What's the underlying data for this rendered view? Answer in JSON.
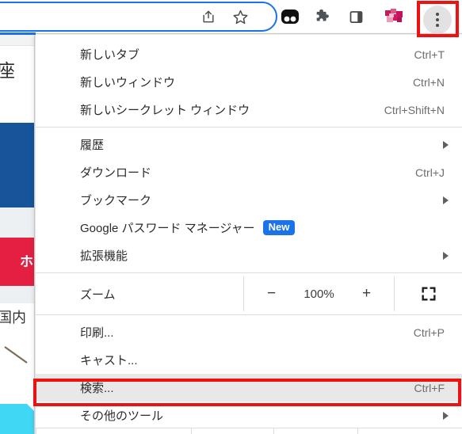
{
  "toolbar": {
    "icons": [
      {
        "name": "share-icon",
        "glyph": "share"
      },
      {
        "name": "bookmark-star-icon",
        "glyph": "star"
      },
      {
        "name": "extension-pin-goggles-icon",
        "glyph": "goggles"
      },
      {
        "name": "extensions-puzzle-icon",
        "glyph": "puzzle"
      },
      {
        "name": "side-panel-icon",
        "glyph": "panel"
      },
      {
        "name": "profile-avatar-icon",
        "glyph": "avatar"
      }
    ],
    "menu_button_label": "Google Chrome の設定",
    "accent_color": "#1a73e8",
    "highlight_color": "#ee1111"
  },
  "background": {
    "sidebar_text_1": "座",
    "sidebar_red_text": "ホ",
    "sidebar_text_2": "国内",
    "blue_color": "#17549a",
    "red_color": "#e51f42",
    "cyan_color": "#40d7f5"
  },
  "menu": {
    "groups": [
      {
        "items": [
          {
            "label": "新しいタブ",
            "accel": "Ctrl+T",
            "arrow": false,
            "badge": "",
            "highlighted": false
          },
          {
            "label": "新しいウィンドウ",
            "accel": "Ctrl+N",
            "arrow": false,
            "badge": "",
            "highlighted": false
          },
          {
            "label": "新しいシークレット ウィンドウ",
            "accel": "Ctrl+Shift+N",
            "arrow": false,
            "badge": "",
            "highlighted": false
          }
        ]
      },
      {
        "items": [
          {
            "label": "履歴",
            "accel": "",
            "arrow": true,
            "badge": "",
            "highlighted": false
          },
          {
            "label": "ダウンロード",
            "accel": "Ctrl+J",
            "arrow": false,
            "badge": "",
            "highlighted": false
          },
          {
            "label": "ブックマーク",
            "accel": "",
            "arrow": true,
            "badge": "",
            "highlighted": false
          },
          {
            "label": "Google パスワード マネージャー",
            "accel": "",
            "arrow": false,
            "badge": "New",
            "highlighted": false
          },
          {
            "label": "拡張機能",
            "accel": "",
            "arrow": true,
            "badge": "",
            "highlighted": false
          }
        ]
      }
    ],
    "zoom_row": {
      "label": "ズーム",
      "minus_label": "−",
      "percent": "100%",
      "plus_label": "+",
      "fullscreen_name": "fullscreen-icon"
    },
    "groups_after_zoom": [
      {
        "items": [
          {
            "label": "印刷...",
            "accel": "Ctrl+P",
            "arrow": false,
            "badge": "",
            "highlighted": false
          },
          {
            "label": "キャスト...",
            "accel": "",
            "arrow": false,
            "badge": "",
            "highlighted": false
          },
          {
            "label": "検索...",
            "accel": "Ctrl+F",
            "arrow": false,
            "badge": "",
            "highlighted": true
          },
          {
            "label": "その他のツール",
            "accel": "",
            "arrow": true,
            "badge": "",
            "highlighted": false
          }
        ]
      }
    ]
  }
}
